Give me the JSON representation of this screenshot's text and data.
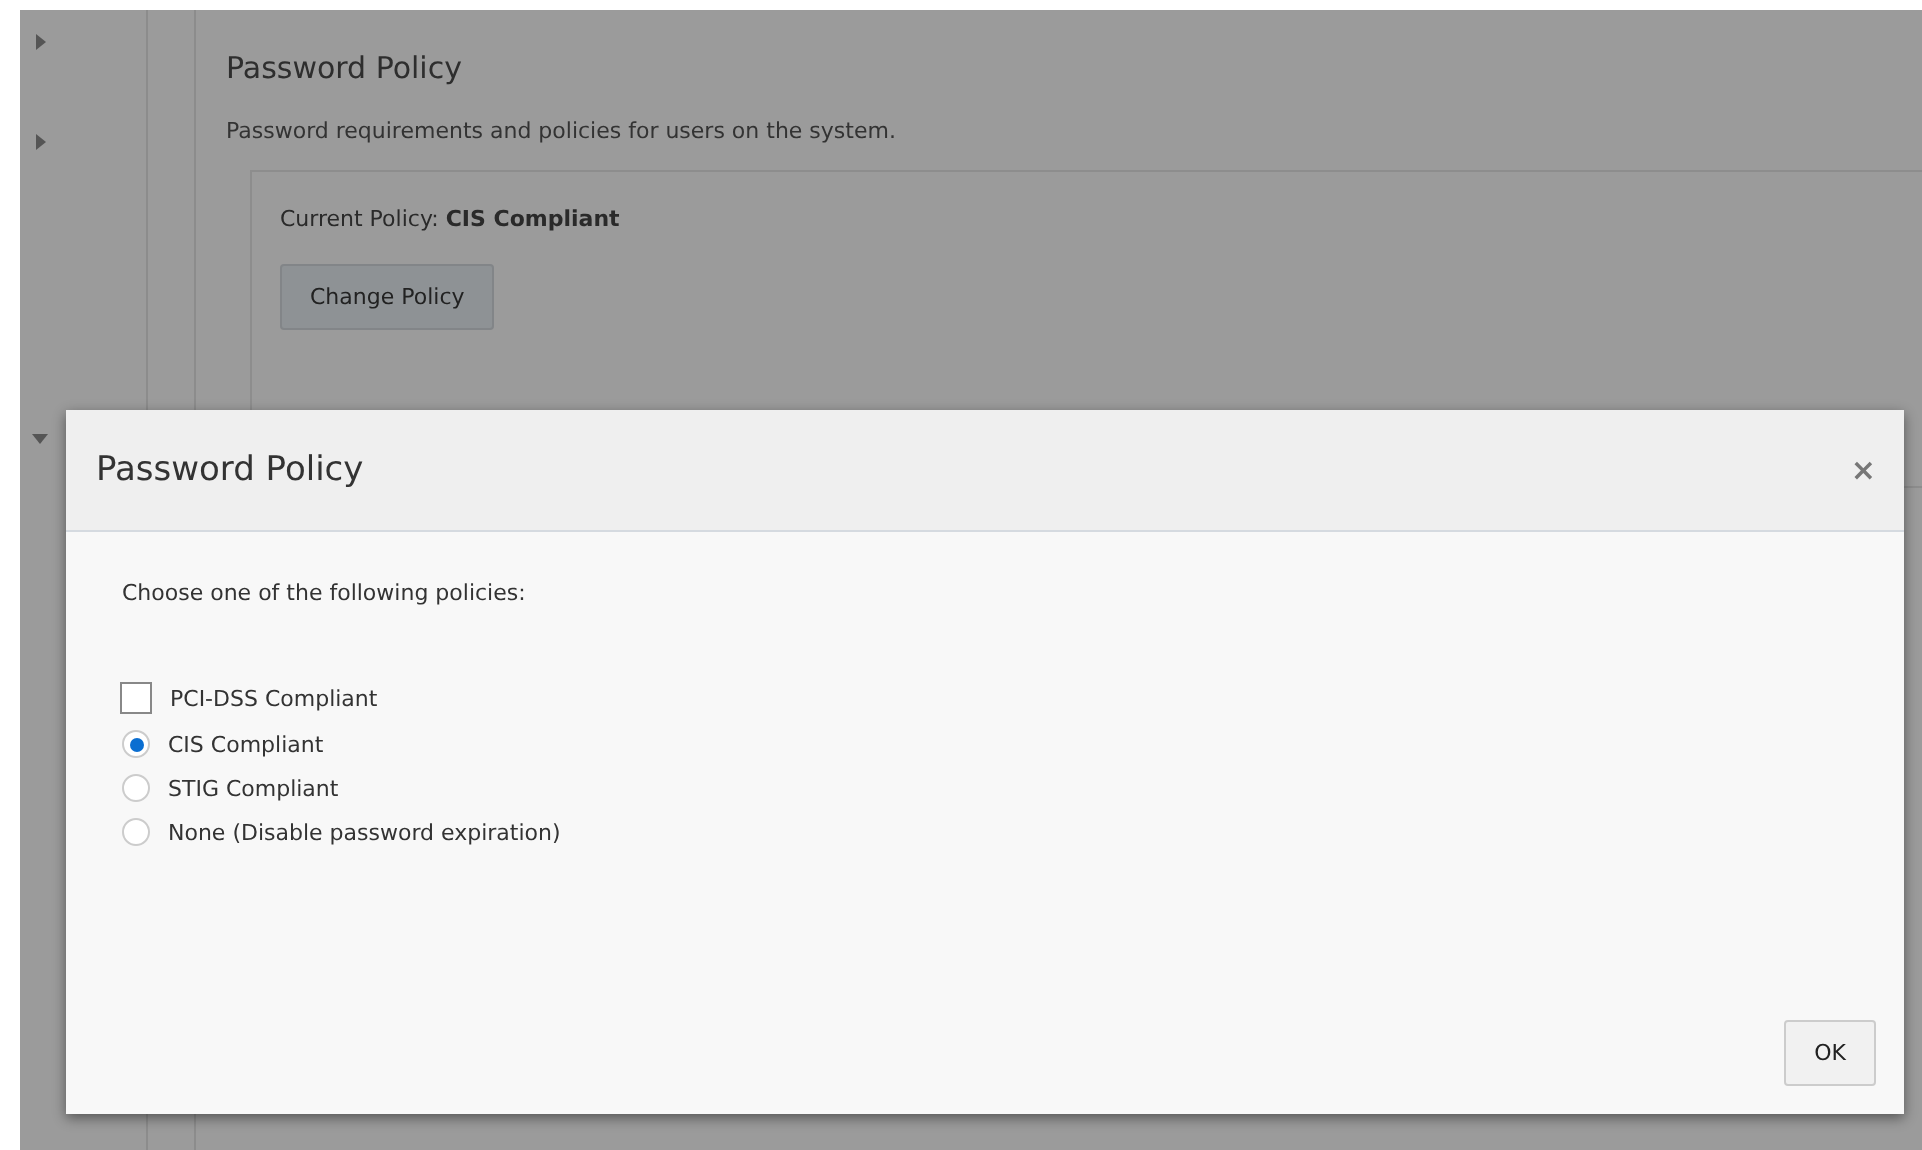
{
  "sidebar": {
    "items": [
      {
        "expanded": false
      },
      {
        "expanded": false
      },
      {
        "expanded": true
      }
    ]
  },
  "section": {
    "title": "Password Policy",
    "description": "Password requirements and policies for users on the system.",
    "current_policy": "Current Policy: **CIS Compliant**",
    "button": "Change Policy"
  },
  "dialog": {
    "title": "Password Policy",
    "close": "×",
    "prompt": "Choose one of the following policies:",
    "options": [
      {
        "kind": "checkbox",
        "label": "PCI-DSS Compliant",
        "selected": false
      },
      {
        "kind": "radio",
        "label": "CIS Compliant",
        "selected": true
      },
      {
        "kind": "radio",
        "label": "STIG Compliant",
        "selected": false
      },
      {
        "kind": "radio",
        "label": "None (Disable password expiration)",
        "selected": false
      }
    ],
    "buttons": [
      "OK"
    ]
  }
}
